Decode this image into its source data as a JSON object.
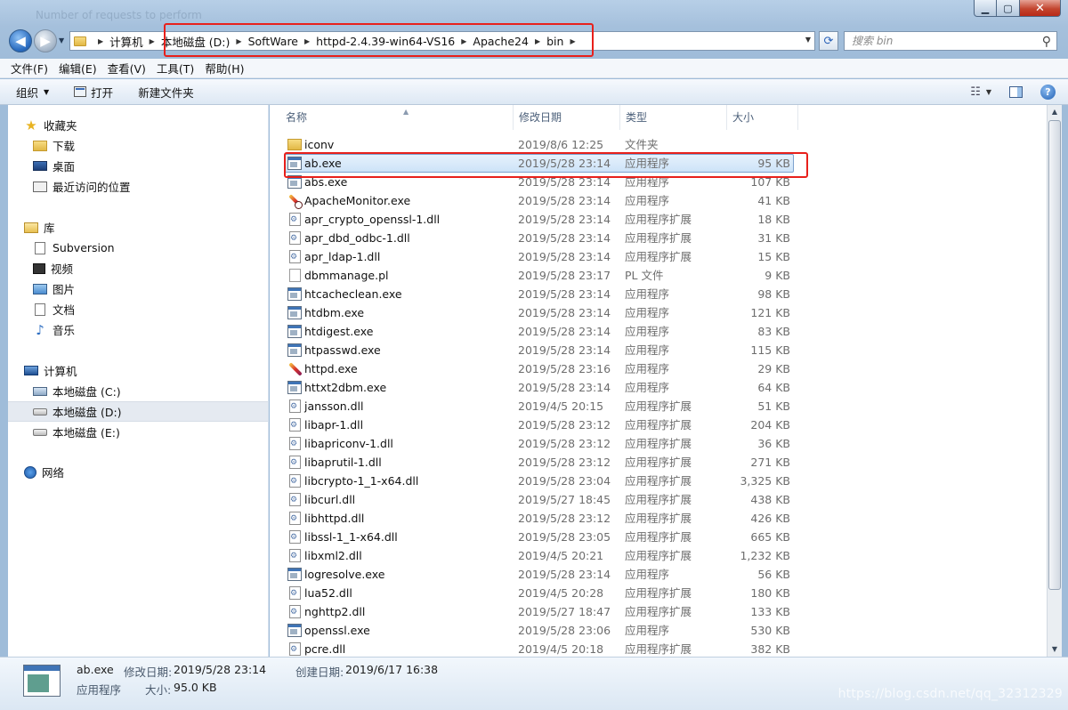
{
  "window": {
    "faded_title": "Number of requests to perform"
  },
  "nav": {
    "back_label": "◀",
    "forward_label": "▶",
    "breadcrumbs": [
      "计算机",
      "本地磁盘 (D:)",
      "SoftWare",
      "httpd-2.4.39-win64-VS16",
      "Apache24",
      "bin"
    ],
    "search_placeholder": "搜索 bin"
  },
  "menubar": [
    "文件(F)",
    "编辑(E)",
    "查看(V)",
    "工具(T)",
    "帮助(H)"
  ],
  "toolbar": {
    "organize": "组织",
    "open": "打开",
    "new_folder": "新建文件夹"
  },
  "navpane": {
    "favorites": {
      "label": "收藏夹",
      "items": [
        "下载",
        "桌面",
        "最近访问的位置"
      ]
    },
    "libraries": {
      "label": "库",
      "items": [
        "Subversion",
        "视频",
        "图片",
        "文档",
        "音乐"
      ]
    },
    "computer": {
      "label": "计算机",
      "items": [
        "本地磁盘 (C:)",
        "本地磁盘 (D:)",
        "本地磁盘 (E:)"
      ]
    },
    "network": {
      "label": "网络"
    },
    "selected": "本地磁盘 (D:)"
  },
  "columns": {
    "name": "名称",
    "date": "修改日期",
    "type": "类型",
    "size": "大小"
  },
  "files": [
    {
      "name": "iconv",
      "date": "2019/8/6 12:25",
      "type": "文件夹",
      "size": "",
      "icon": "folder"
    },
    {
      "name": "ab.exe",
      "date": "2019/5/28 23:14",
      "type": "应用程序",
      "size": "95 KB",
      "icon": "exe",
      "selected": true
    },
    {
      "name": "abs.exe",
      "date": "2019/5/28 23:14",
      "type": "应用程序",
      "size": "107 KB",
      "icon": "exe"
    },
    {
      "name": "ApacheMonitor.exe",
      "date": "2019/5/28 23:14",
      "type": "应用程序",
      "size": "41 KB",
      "icon": "feather-monitor"
    },
    {
      "name": "apr_crypto_openssl-1.dll",
      "date": "2019/5/28 23:14",
      "type": "应用程序扩展",
      "size": "18 KB",
      "icon": "dll"
    },
    {
      "name": "apr_dbd_odbc-1.dll",
      "date": "2019/5/28 23:14",
      "type": "应用程序扩展",
      "size": "31 KB",
      "icon": "dll"
    },
    {
      "name": "apr_ldap-1.dll",
      "date": "2019/5/28 23:14",
      "type": "应用程序扩展",
      "size": "15 KB",
      "icon": "dll"
    },
    {
      "name": "dbmmanage.pl",
      "date": "2019/5/28 23:17",
      "type": "PL 文件",
      "size": "9 KB",
      "icon": "pl"
    },
    {
      "name": "htcacheclean.exe",
      "date": "2019/5/28 23:14",
      "type": "应用程序",
      "size": "98 KB",
      "icon": "exe"
    },
    {
      "name": "htdbm.exe",
      "date": "2019/5/28 23:14",
      "type": "应用程序",
      "size": "121 KB",
      "icon": "exe"
    },
    {
      "name": "htdigest.exe",
      "date": "2019/5/28 23:14",
      "type": "应用程序",
      "size": "83 KB",
      "icon": "exe"
    },
    {
      "name": "htpasswd.exe",
      "date": "2019/5/28 23:14",
      "type": "应用程序",
      "size": "115 KB",
      "icon": "exe"
    },
    {
      "name": "httpd.exe",
      "date": "2019/5/28 23:16",
      "type": "应用程序",
      "size": "29 KB",
      "icon": "feather"
    },
    {
      "name": "httxt2dbm.exe",
      "date": "2019/5/28 23:14",
      "type": "应用程序",
      "size": "64 KB",
      "icon": "exe"
    },
    {
      "name": "jansson.dll",
      "date": "2019/4/5 20:15",
      "type": "应用程序扩展",
      "size": "51 KB",
      "icon": "dll"
    },
    {
      "name": "libapr-1.dll",
      "date": "2019/5/28 23:12",
      "type": "应用程序扩展",
      "size": "204 KB",
      "icon": "dll"
    },
    {
      "name": "libapriconv-1.dll",
      "date": "2019/5/28 23:12",
      "type": "应用程序扩展",
      "size": "36 KB",
      "icon": "dll"
    },
    {
      "name": "libaprutil-1.dll",
      "date": "2019/5/28 23:12",
      "type": "应用程序扩展",
      "size": "271 KB",
      "icon": "dll"
    },
    {
      "name": "libcrypto-1_1-x64.dll",
      "date": "2019/5/28 23:04",
      "type": "应用程序扩展",
      "size": "3,325 KB",
      "icon": "dll"
    },
    {
      "name": "libcurl.dll",
      "date": "2019/5/27 18:45",
      "type": "应用程序扩展",
      "size": "438 KB",
      "icon": "dll"
    },
    {
      "name": "libhttpd.dll",
      "date": "2019/5/28 23:12",
      "type": "应用程序扩展",
      "size": "426 KB",
      "icon": "dll"
    },
    {
      "name": "libssl-1_1-x64.dll",
      "date": "2019/5/28 23:05",
      "type": "应用程序扩展",
      "size": "665 KB",
      "icon": "dll"
    },
    {
      "name": "libxml2.dll",
      "date": "2019/4/5 20:21",
      "type": "应用程序扩展",
      "size": "1,232 KB",
      "icon": "dll"
    },
    {
      "name": "logresolve.exe",
      "date": "2019/5/28 23:14",
      "type": "应用程序",
      "size": "56 KB",
      "icon": "exe"
    },
    {
      "name": "lua52.dll",
      "date": "2019/4/5 20:28",
      "type": "应用程序扩展",
      "size": "180 KB",
      "icon": "dll"
    },
    {
      "name": "nghttp2.dll",
      "date": "2019/5/27 18:47",
      "type": "应用程序扩展",
      "size": "133 KB",
      "icon": "dll"
    },
    {
      "name": "openssl.exe",
      "date": "2019/5/28 23:06",
      "type": "应用程序",
      "size": "530 KB",
      "icon": "exe"
    },
    {
      "name": "pcre.dll",
      "date": "2019/4/5 20:18",
      "type": "应用程序扩展",
      "size": "382 KB",
      "icon": "dll"
    }
  ],
  "details": {
    "name": "ab.exe",
    "modified_label": "修改日期:",
    "modified": "2019/5/28 23:14",
    "created_label": "创建日期:",
    "created": "2019/6/17 16:38",
    "type": "应用程序",
    "size_label": "大小:",
    "size": "95.0 KB"
  },
  "watermark": "https://blog.csdn.net/qq_32312329",
  "colors": {
    "highlight": "#e8201b",
    "selection": "#cde3f8"
  }
}
